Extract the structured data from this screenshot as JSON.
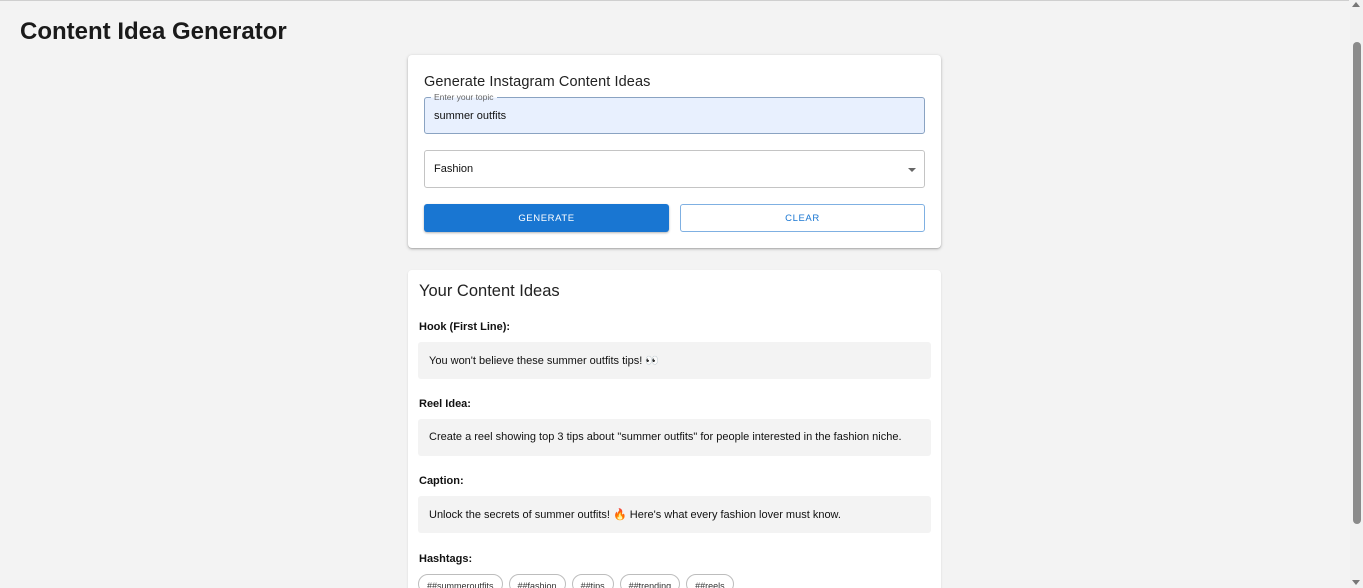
{
  "app": {
    "title": "Content Idea Generator"
  },
  "form": {
    "heading": "Generate Instagram Content Ideas",
    "topic": {
      "label": "Enter your topic",
      "value": "summer outfits"
    },
    "niche": {
      "selected": "Fashion"
    },
    "generate_label": "GENERATE",
    "clear_label": "CLEAR"
  },
  "results": {
    "heading": "Your Content Ideas",
    "hook": {
      "label": "Hook (First Line):",
      "text": "You won't believe these summer outfits tips! 👀"
    },
    "reel": {
      "label": "Reel Idea:",
      "text": "Create a reel showing top 3 tips about \"summer outfits\" for people interested in the fashion niche."
    },
    "caption": {
      "label": "Caption:",
      "text": "Unlock the secrets of summer outfits! 🔥 Here's what every fashion lover must know."
    },
    "hashtags": {
      "label": "Hashtags:",
      "tags": [
        "##summeroutfits",
        "##fashion",
        "##tips",
        "##trending",
        "##reels"
      ]
    }
  },
  "colors": {
    "primary": "#1976d2",
    "background": "#f3f3f3",
    "input_fill": "#e8f0fe"
  }
}
